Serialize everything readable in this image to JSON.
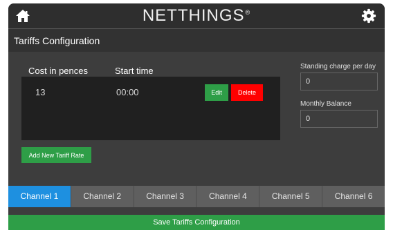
{
  "header": {
    "brand": "NETTHINGS",
    "registered_mark": "®",
    "home_icon": "home-icon",
    "settings_icon": "gear-icon"
  },
  "section": {
    "title": "Tariffs Configuration"
  },
  "tariff_table": {
    "columns": [
      "Cost in pences",
      "Start time"
    ],
    "rows": [
      {
        "cost": "13",
        "start_time": "00:00",
        "edit_label": "Edit",
        "delete_label": "Delete"
      }
    ],
    "add_label": "Add New Tariff Rate"
  },
  "side_fields": {
    "standing_charge_label": "Standing charge per day",
    "standing_charge_value": "0",
    "monthly_balance_label": "Monthly Balance",
    "monthly_balance_value": "0"
  },
  "channels": {
    "active_index": 0,
    "tabs": [
      "Channel 1",
      "Channel 2",
      "Channel 3",
      "Channel 4",
      "Channel 5",
      "Channel 6"
    ]
  },
  "footer": {
    "save_label": "Save Tariffs Configuration"
  },
  "colors": {
    "accent_blue": "#1e90e0",
    "accent_green": "#2e9e47",
    "danger_red": "#ff0000",
    "panel_dark": "#202020"
  }
}
